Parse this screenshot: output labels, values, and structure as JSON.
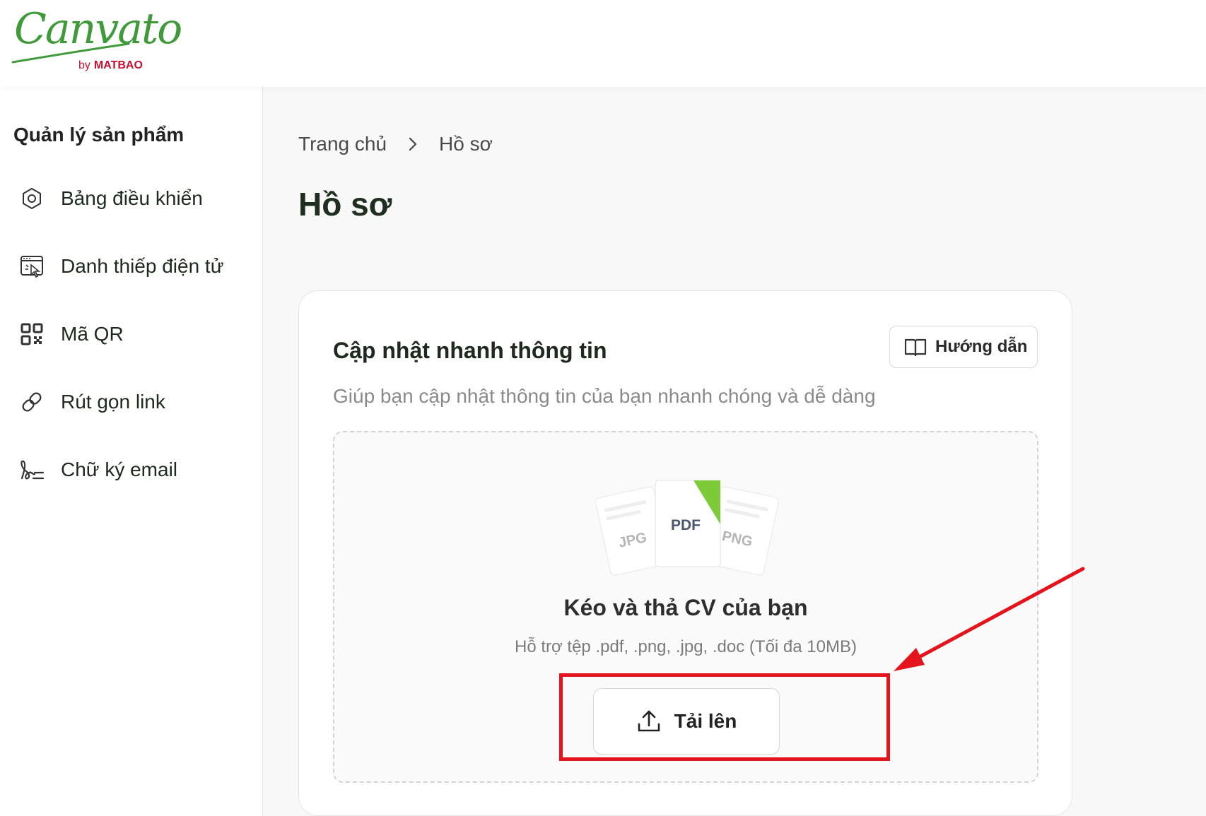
{
  "brand": {
    "logo_script": "Canvato",
    "by_text": "by",
    "by_brand": "MATBAO",
    "colors": {
      "green": "#3f9a3a",
      "red": "#c8102e"
    }
  },
  "sidebar": {
    "title": "Quản lý sản phẩm",
    "items": [
      {
        "label": "Bảng điều khiển",
        "icon": "hexagon-settings-icon"
      },
      {
        "label": "Danh thiếp điện tử",
        "icon": "digital-card-icon"
      },
      {
        "label": "Mã QR",
        "icon": "qr-code-icon"
      },
      {
        "label": "Rút gọn link",
        "icon": "link-icon"
      },
      {
        "label": "Chữ ký email",
        "icon": "signature-icon"
      }
    ]
  },
  "breadcrumb": {
    "home": "Trang chủ",
    "current": "Hồ sơ"
  },
  "page": {
    "title": "Hồ sơ"
  },
  "card": {
    "title": "Cập nhật nhanh thông tin",
    "subtitle": "Giúp bạn cập nhật thông tin của bạn nhanh chóng và dễ dàng",
    "guide_button": "Hướng dẫn",
    "dropzone": {
      "file_types": [
        "JPG",
        "PDF",
        "PNG"
      ],
      "title": "Kéo và thả CV của bạn",
      "hint": "Hỗ trợ tệp .pdf, .png, .jpg, .doc (Tối đa 10MB)",
      "upload_button": "Tải lên"
    }
  },
  "annotation": {
    "color": "#e3141b"
  }
}
